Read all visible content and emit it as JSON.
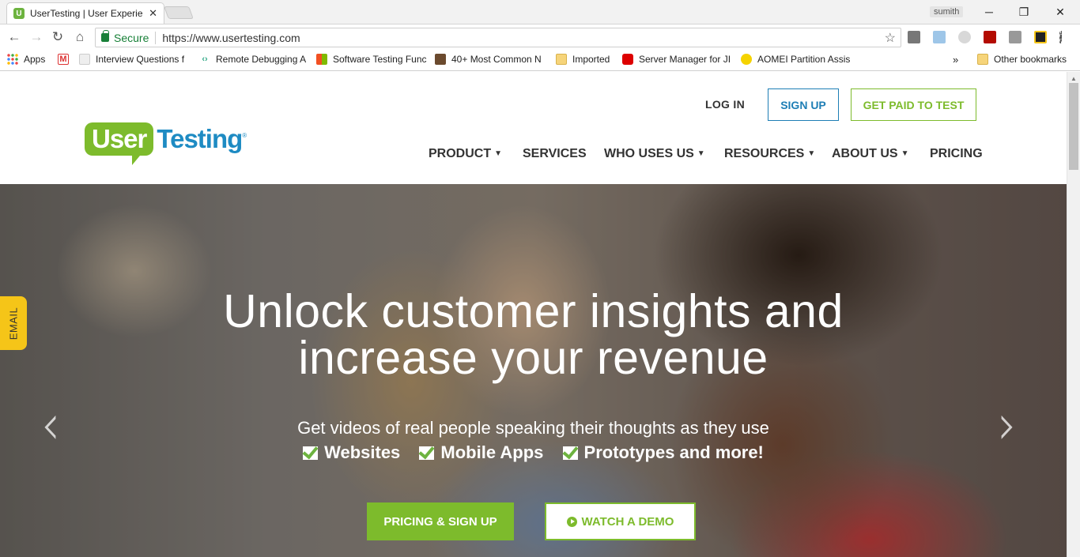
{
  "browser": {
    "tab_title": "UserTesting | User Experie",
    "tab_close": "✕",
    "favicon_letter": "U",
    "profile_name": "sumith",
    "window_minimize": "─",
    "window_restore": "❐",
    "window_close": "✕",
    "secure_label": "Secure",
    "url": "https://www.usertesting.com",
    "nav_back": "←",
    "nav_forward": "→",
    "nav_reload": "↻",
    "nav_home": "⌂",
    "star": "☆"
  },
  "bookmarks": {
    "apps": "Apps",
    "items": [
      "Interview Questions f",
      "Remote Debugging A",
      "Software Testing Func",
      "40+ Most Common N",
      "Imported",
      "Server Manager for JI",
      "AOMEI Partition Assis"
    ],
    "overflow": "»",
    "other": "Other bookmarks"
  },
  "site": {
    "logo_user": "User",
    "logo_testing": "Testing",
    "logo_reg": "®",
    "login": "LOG IN",
    "signup": "SIGN UP",
    "get_paid": "GET PAID TO TEST",
    "nav": [
      "PRODUCT",
      "SERVICES",
      "WHO USES US",
      "RESOURCES",
      "ABOUT US",
      "PRICING"
    ],
    "caret": "▼"
  },
  "hero": {
    "email_tab": "EMAIL",
    "headline_line1": "Unlock customer insights and",
    "headline_line2": "increase your revenue",
    "subline": "Get videos of real people speaking their thoughts as they use",
    "features": [
      "Websites",
      "Mobile Apps",
      "Prototypes and more!"
    ],
    "btn_pricing": "PRICING & SIGN UP",
    "btn_demo": "WATCH A DEMO",
    "prev_arrow": "‹",
    "next_arrow": "›"
  },
  "colors": {
    "brand_green": "#7dbb2c",
    "brand_blue": "#1e8bc3",
    "email_yellow": "#f5c518"
  }
}
